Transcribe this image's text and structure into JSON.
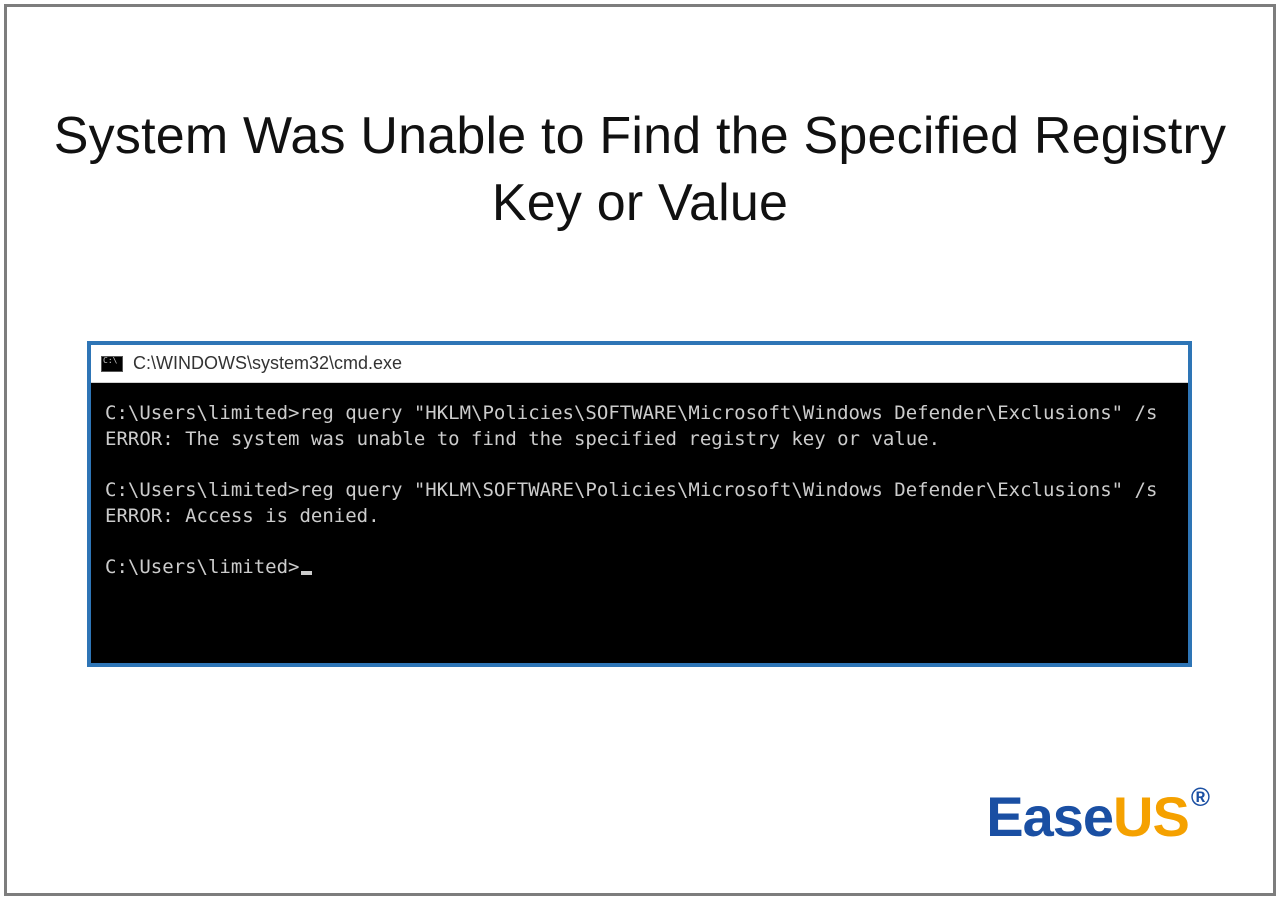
{
  "heading": "System Was Unable to Find the Specified Registry Key or Value",
  "cmd": {
    "title": "C:\\WINDOWS\\system32\\cmd.exe",
    "lines": {
      "l1": "C:\\Users\\limited>reg query \"HKLM\\Policies\\SOFTWARE\\Microsoft\\Windows Defender\\Exclusions\" /s",
      "l2": "ERROR: The system was unable to find the specified registry key or value.",
      "l3": "",
      "l4": "C:\\Users\\limited>reg query \"HKLM\\SOFTWARE\\Policies\\Microsoft\\Windows Defender\\Exclusions\" /s",
      "l5": "ERROR: Access is denied.",
      "l6": "",
      "l7": "C:\\Users\\limited>"
    }
  },
  "logo": {
    "part1": "Ease",
    "part2": "US",
    "reg": "®"
  }
}
